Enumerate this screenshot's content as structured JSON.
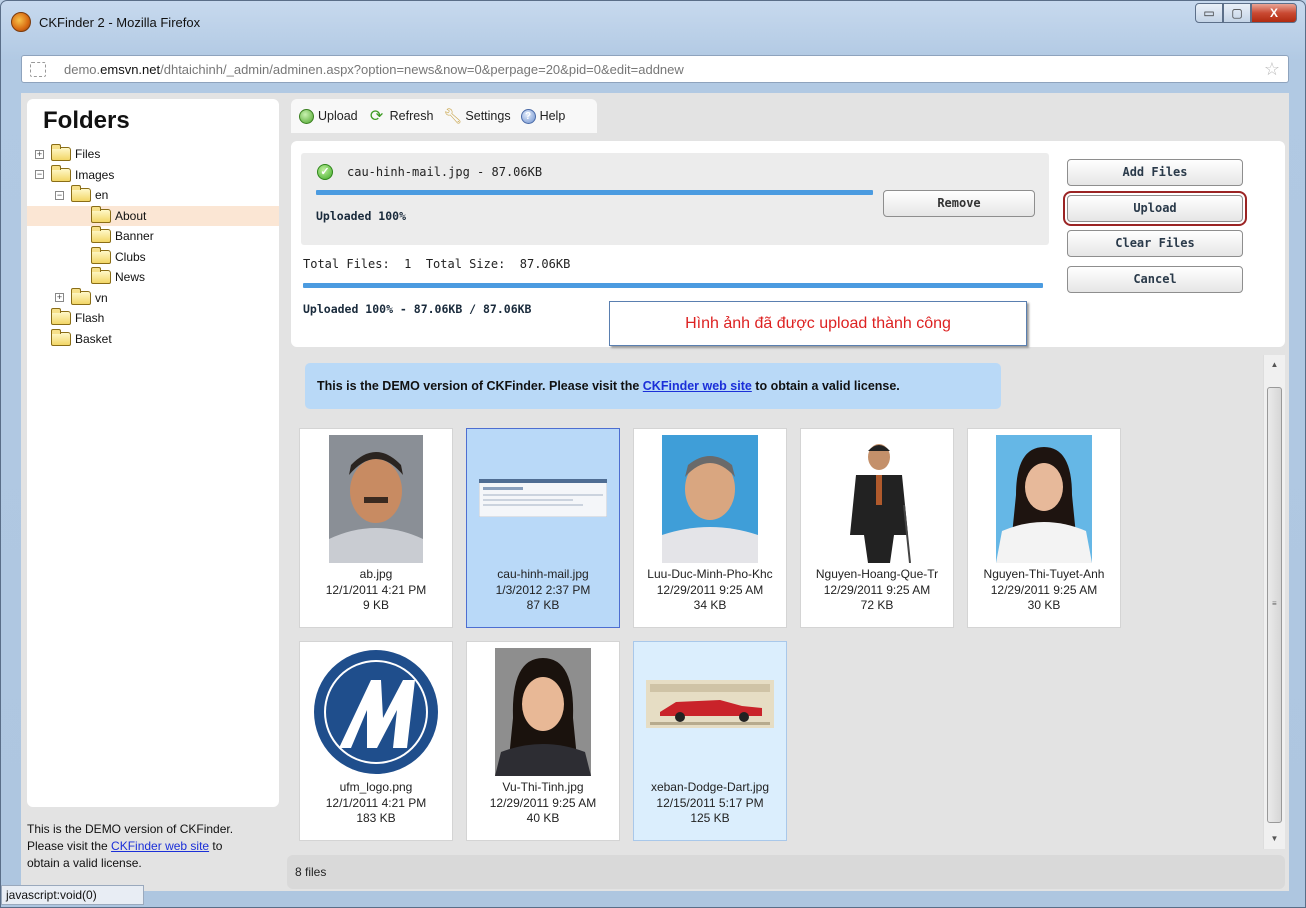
{
  "window": {
    "title": "CKFinder 2 - Mozilla Firefox",
    "controls": {
      "minimize": "▭",
      "maximize": "▢",
      "close": "X"
    }
  },
  "address_bar": {
    "url_prefix": "demo.",
    "url_domain": "emsvn.net",
    "url_rest": "/dhtaichinh/_admin/adminen.aspx?option=news&now=0&perpage=20&pid=0&edit=addnew"
  },
  "sidebar": {
    "title": "Folders",
    "tree": [
      {
        "label": "Files",
        "expander": "+"
      },
      {
        "label": "Images",
        "expander": "−"
      },
      {
        "label": "en",
        "expander": "−"
      },
      {
        "label": "About",
        "selected": true
      },
      {
        "label": "Banner"
      },
      {
        "label": "Clubs"
      },
      {
        "label": "News"
      },
      {
        "label": "vn",
        "expander": "+"
      },
      {
        "label": "Flash"
      },
      {
        "label": "Basket"
      }
    ],
    "demo_note_1": "This is the DEMO version of CKFinder.",
    "demo_note_2": "Please visit the ",
    "demo_note_link": "CKFinder web site",
    "demo_note_3": " to",
    "demo_note_4": "obtain a valid license."
  },
  "status_tip": "javascript:void(0)",
  "toolbar": {
    "upload": "Upload",
    "refresh": "Refresh",
    "settings": "Settings",
    "help": "Help"
  },
  "upload_panel": {
    "file_name": "cau-hinh-mail.jpg - 87.06KB",
    "file_progress": 1.0,
    "file_status": "Uploaded 100%",
    "remove_label": "Remove",
    "totals": "Total Files:  1  Total Size:  87.06KB",
    "total_progress": 1.0,
    "total_status": "Uploaded 100% - 87.06KB / 87.06KB",
    "callout": "Hình ảnh đã được upload thành công",
    "buttons": {
      "add_files": "Add Files",
      "upload": "Upload",
      "clear_files": "Clear Files",
      "cancel": "Cancel"
    }
  },
  "files_area": {
    "banner_text": "This is the DEMO version of CKFinder. Please visit the ",
    "banner_link": "CKFinder web site",
    "banner_end": " to obtain a valid license.",
    "files": [
      {
        "name": "ab.jpg",
        "date": "12/1/2011 4:21 PM",
        "size": "9 KB"
      },
      {
        "name": "cau-hinh-mail.jpg",
        "date": "1/3/2012 2:37 PM",
        "size": "87 KB",
        "state": "selected"
      },
      {
        "name": "Luu-Duc-Minh-Pho-Khc",
        "date": "12/29/2011 9:25 AM",
        "size": "34 KB"
      },
      {
        "name": "Nguyen-Hoang-Que-Tr",
        "date": "12/29/2011 9:25 AM",
        "size": "72 KB"
      },
      {
        "name": "Nguyen-Thi-Tuyet-Anh",
        "date": "12/29/2011 9:25 AM",
        "size": "30 KB"
      },
      {
        "name": "ufm_logo.png",
        "date": "12/1/2011 4:21 PM",
        "size": "183 KB"
      },
      {
        "name": "Vu-Thi-Tinh.jpg",
        "date": "12/29/2011 9:25 AM",
        "size": "40 KB"
      },
      {
        "name": "xeban-Dodge-Dart.jpg",
        "date": "12/15/2011 5:17 PM",
        "size": "125 KB",
        "state": "hover"
      }
    ]
  },
  "status_bar": "8 files",
  "colors": {
    "progress": "#4b9be0",
    "callout_text": "#dd2222",
    "selected_bg": "#b9d9f8",
    "link": "#1b2fd8",
    "banner_bg": "#b9d9f7"
  }
}
